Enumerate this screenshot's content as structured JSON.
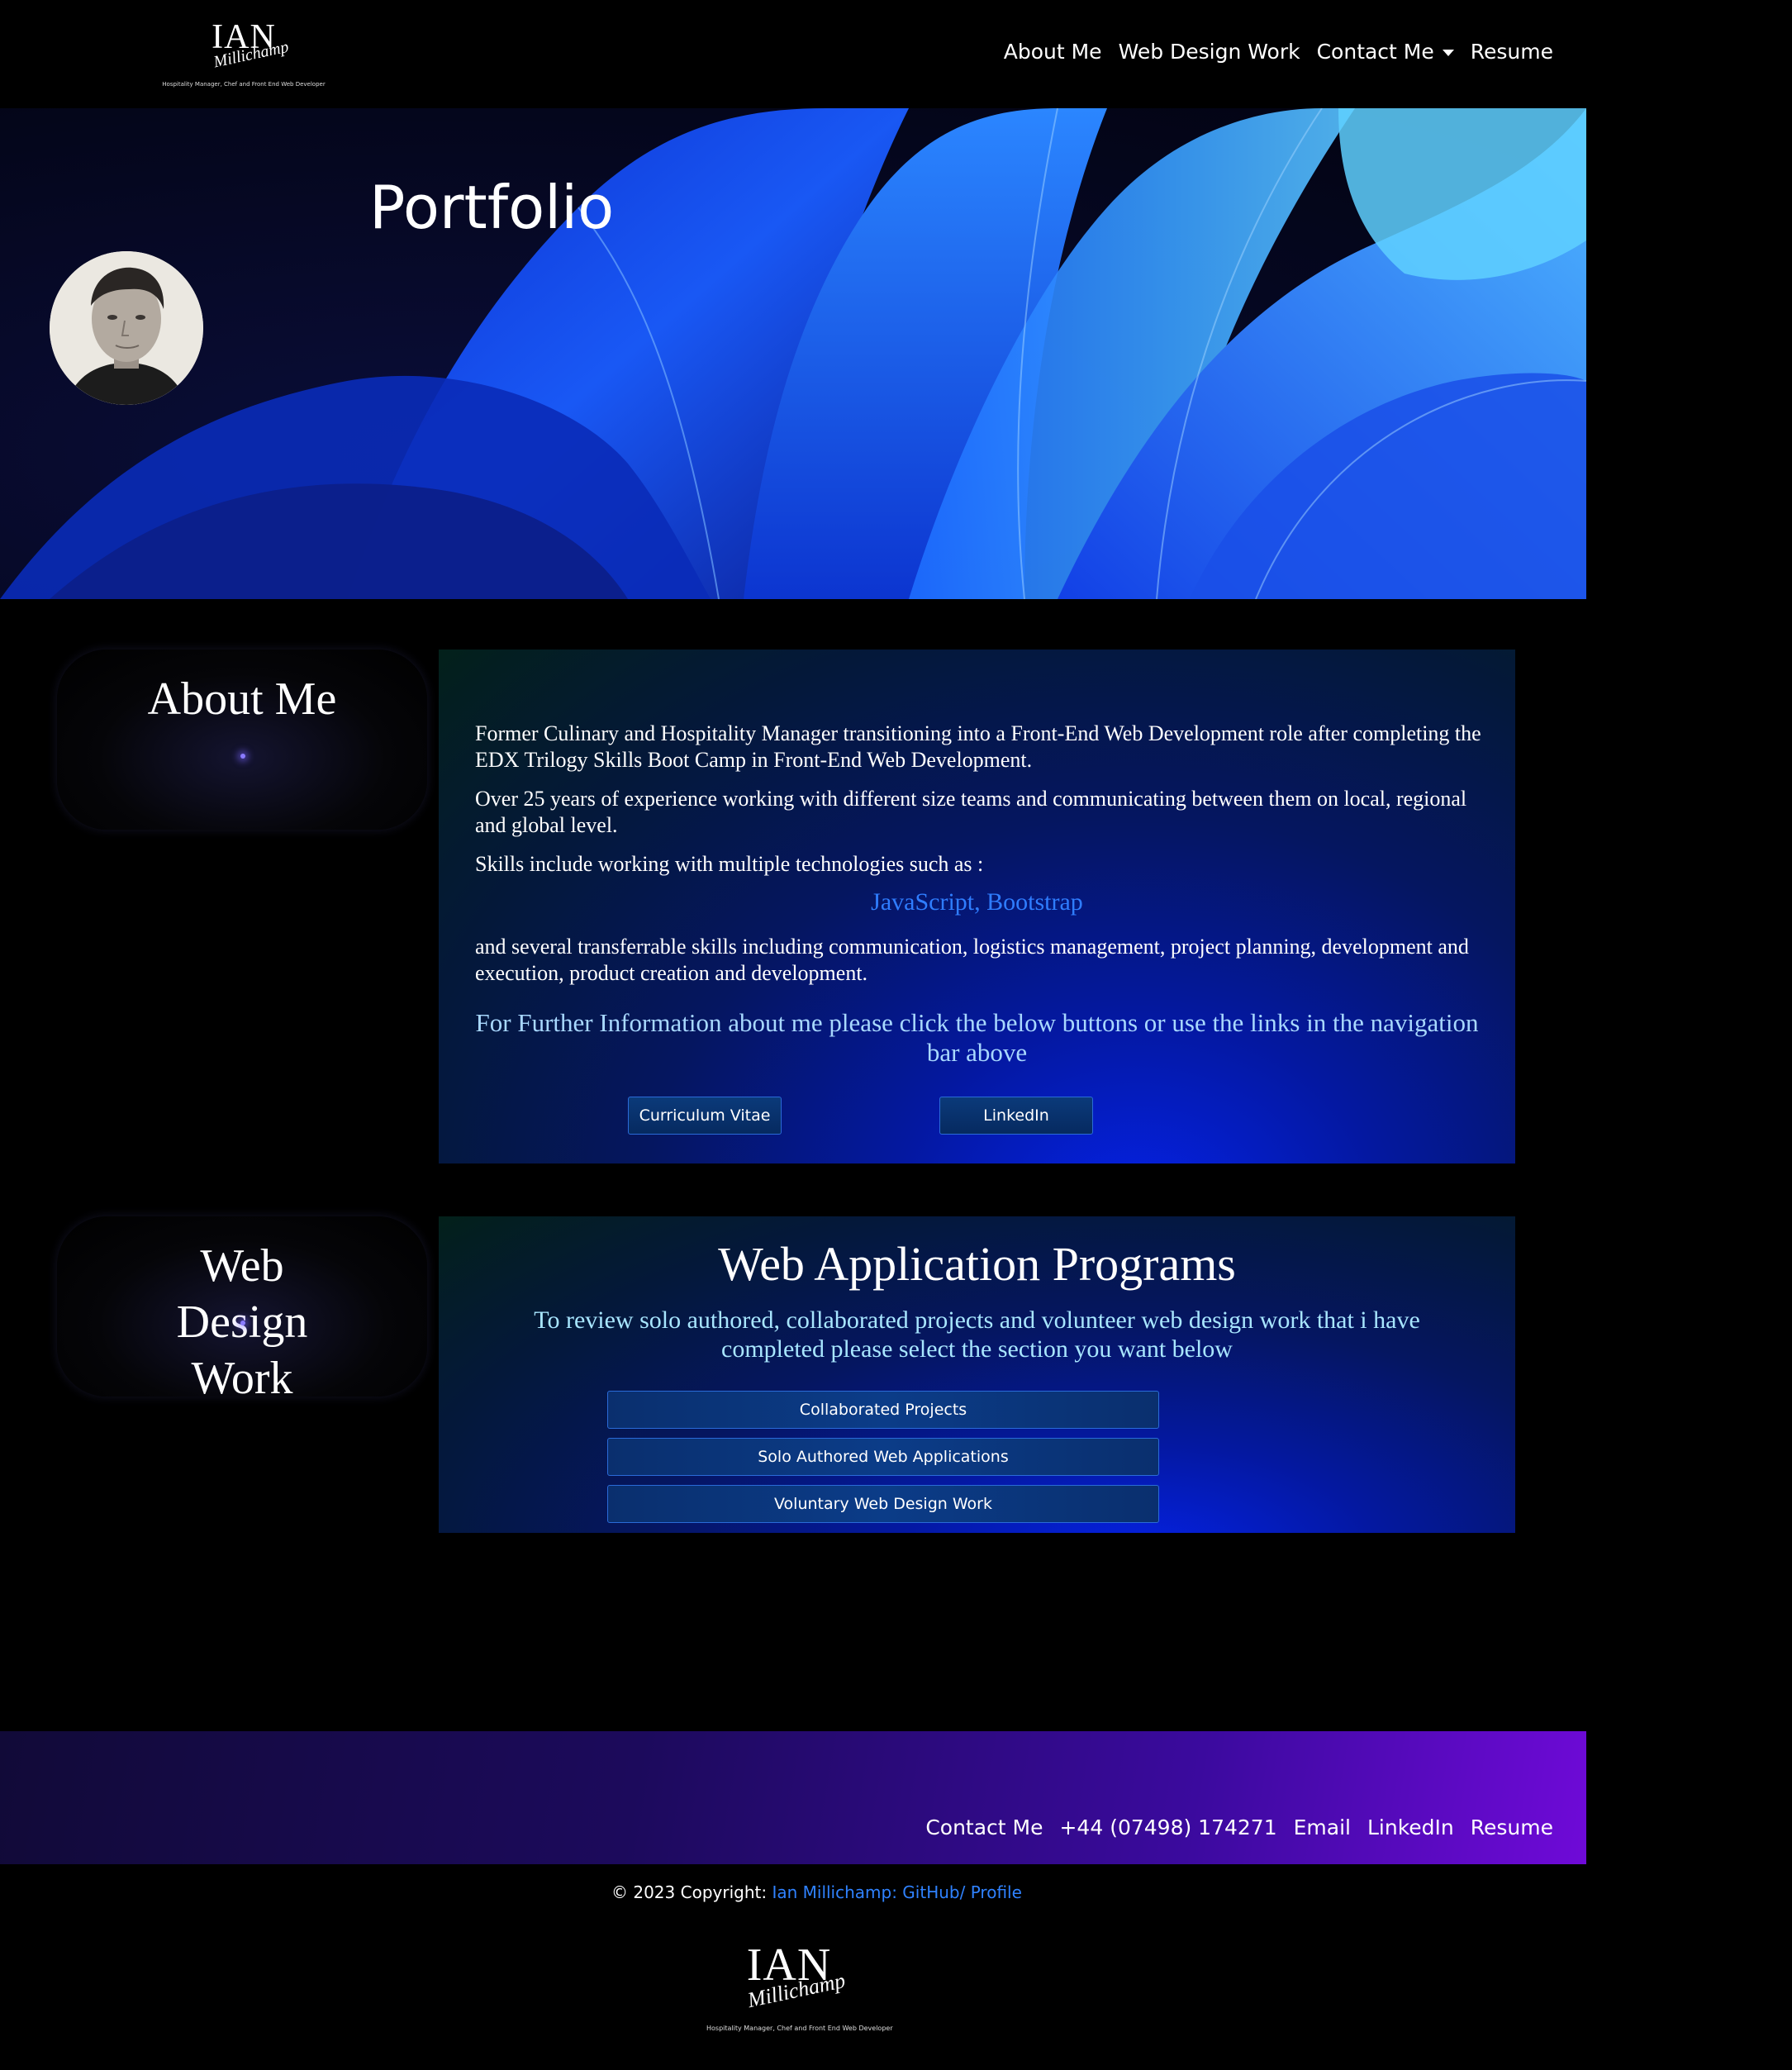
{
  "header": {
    "logo": {
      "name": "IAN",
      "signature": "Millichamp",
      "tagline": "Hospitality Manager, Chef and Front End Web Developer"
    },
    "nav": [
      {
        "label": "About Me"
      },
      {
        "label": "Web Design Work"
      },
      {
        "label": "Contact Me",
        "dropdown": true
      },
      {
        "label": "Resume"
      }
    ]
  },
  "hero": {
    "title": "Portfolio"
  },
  "about": {
    "side_title": "About Me",
    "paragraph1": "Former Culinary and Hospitality Manager transitioning into a Front-End Web Development role after completing the EDX Trilogy Skills Boot Camp in Front-End Web Development.",
    "paragraph2": "Over 25 years of experience working with different size teams and communicating between them on local, regional and global level.",
    "paragraph3": "Skills include working with multiple technologies such as :",
    "technologies": "JavaScript, Bootstrap",
    "paragraph4": "and several transferrable skills including communication, logistics management, project planning, development and execution, product creation and development.",
    "further_info": "For Further Information about me please click the below buttons or use the links in the navigation bar above",
    "buttons": {
      "cv": "Curriculum Vitae",
      "linkedin": "LinkedIn"
    }
  },
  "web_design": {
    "side_title": "Web Design Work",
    "heading": "Web Application Programs",
    "intro": "To review solo authored, collaborated projects and volunteer web design work that i have completed please select the section you want below",
    "buttons": {
      "collaborated": "Collaborated Projects",
      "solo": "Solo Authored Web Applications",
      "voluntary": "Voluntary Web Design Work"
    }
  },
  "footer": {
    "links": [
      {
        "label": "Contact Me"
      },
      {
        "label": "+44 (07498) 174271"
      },
      {
        "label": "Email"
      },
      {
        "label": "LinkedIn"
      },
      {
        "label": "Resume"
      }
    ],
    "copyright_prefix": "© 2023 Copyright:",
    "copyright_link": "Ian Millichamp: GitHub/ Profile"
  },
  "colors": {
    "background": "#000000",
    "accent_blue": "#2f7dff",
    "footer_gradient_end": "#6f0ad8"
  }
}
